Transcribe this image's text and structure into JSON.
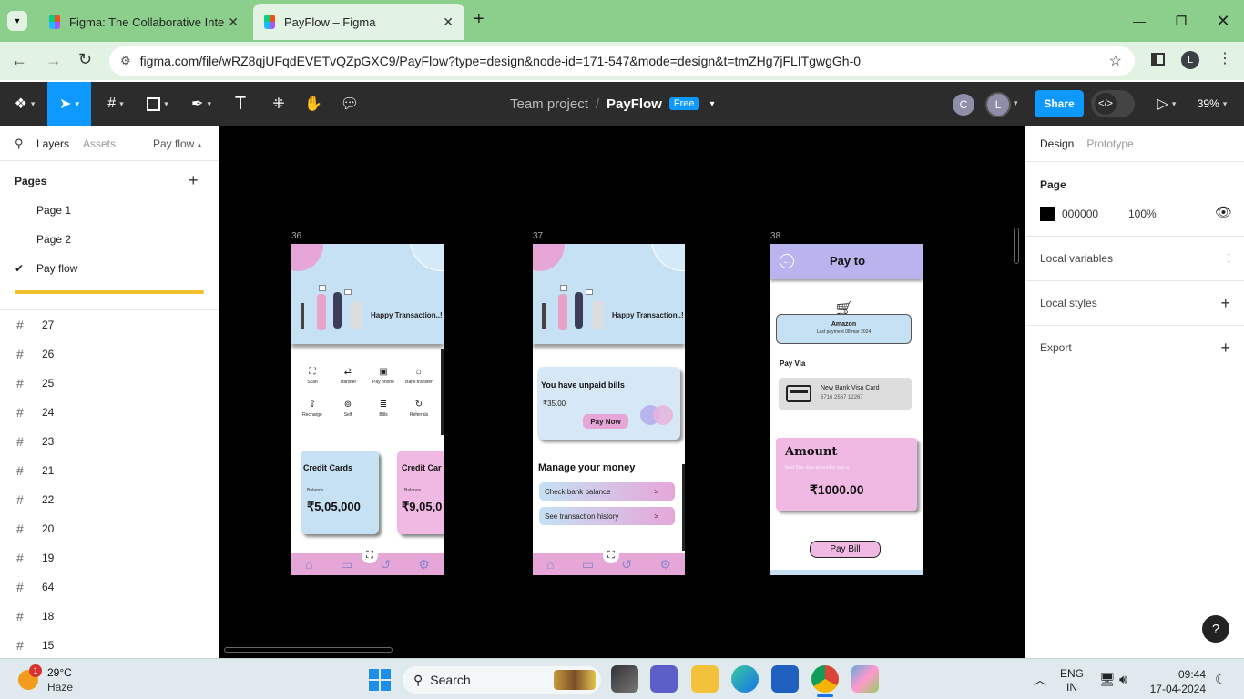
{
  "browser": {
    "tabs": [
      {
        "label": "Figma: The Collaborative Interf",
        "close": "✕"
      },
      {
        "label": "PayFlow – Figma",
        "close": "✕"
      }
    ],
    "new_tab": "+",
    "url": "figma.com/file/wRZ8qjUFqdEVETvQZpGXC9/PayFlow?type=design&node-id=171-547&mode=design&t=tmZHg7jFLITgwgGh-0",
    "profile_initial": "L"
  },
  "figma": {
    "team": "Team project",
    "separator": "/",
    "file": "PayFlow",
    "plan_badge": "Free",
    "avatars": [
      "C",
      "L"
    ],
    "share": "Share",
    "zoom": "39%"
  },
  "left_panel": {
    "tabs": [
      "Layers",
      "Assets"
    ],
    "page_switch": "Pay flow",
    "pages_title": "Pages",
    "pages": [
      {
        "label": "Page 1",
        "active": false
      },
      {
        "label": "Page 2",
        "active": false
      },
      {
        "label": "Pay flow",
        "active": true
      }
    ],
    "layers": [
      "27",
      "26",
      "25",
      "24",
      "23",
      "21",
      "22",
      "20",
      "19",
      "64",
      "18",
      "15"
    ]
  },
  "right_panel": {
    "tabs": [
      "Design",
      "Prototype"
    ],
    "page_title": "Page",
    "bg_hex": "000000",
    "bg_opacity": "100%",
    "sections": [
      "Local variables",
      "Local styles",
      "Export"
    ]
  },
  "frames": {
    "f36": {
      "label": "36",
      "banner": "Happy Transaction..!",
      "actions": [
        "Scan",
        "Transfer",
        "Pay phone",
        "Bank transfer",
        "Recharge",
        "Self",
        "Bills",
        "Referrals"
      ],
      "cards": [
        {
          "title": "Credit Cards",
          "balance_label": "Balance",
          "amount": "₹5,05,000"
        },
        {
          "title": "Credit Car",
          "balance_label": "Balance",
          "amount": "₹9,05,0"
        }
      ]
    },
    "f37": {
      "label": "37",
      "banner": "Happy Transaction..!",
      "unpaid_title": "You have unpaid bills",
      "unpaid_amount": "₹35.00",
      "pay_now": "Pay Now",
      "manage_title": "Manage your money",
      "links": [
        "Check bank balance",
        "See transaction history"
      ],
      "link_arrow": ">"
    },
    "f38": {
      "label": "38",
      "header": "Pay to",
      "merchant": "Amazon",
      "last_payment": "Last payment 08 mar 2024",
      "pay_via": "Pay Via",
      "card_name": "New Bank Visa Card",
      "card_number": "6716 2567 12267",
      "amount_title": "Amount",
      "amount_sub": "Next Due date amount to pay is",
      "amount_value": "₹1000.00",
      "pay_bill": "Pay Bill"
    }
  },
  "taskbar": {
    "weather_temp": "29°C",
    "weather_desc": "Haze",
    "weather_badge": "1",
    "search": "Search",
    "lang1": "ENG",
    "lang2": "IN",
    "time": "09:44",
    "date": "17-04-2024"
  },
  "colors": {
    "browser_green": "#8ccf8c",
    "figma_blue": "#0d99ff",
    "pink": "#e6a6d8",
    "light_blue": "#c5e1f3",
    "lavender": "#b9b3ee"
  }
}
